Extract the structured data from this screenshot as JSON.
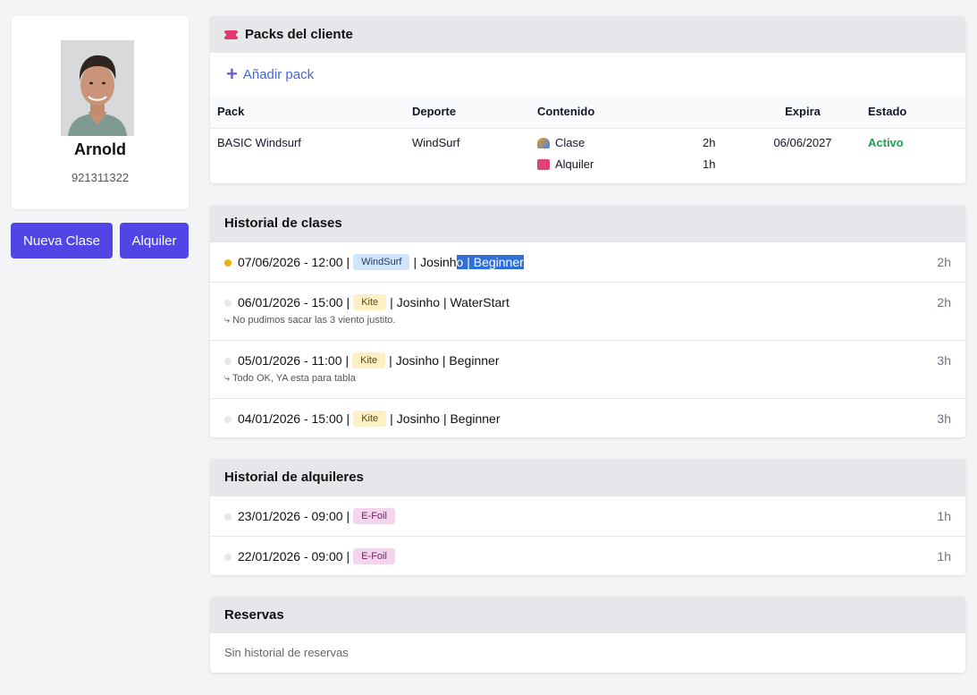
{
  "profile": {
    "name": "Arnold",
    "phone": "921311322"
  },
  "actions": {
    "new_class": "Nueva Clase",
    "rental": "Alquiler"
  },
  "packs": {
    "title": "Packs del cliente",
    "add_label": "Añadir pack",
    "columns": [
      "Pack",
      "Deporte",
      "Contenido",
      "Expira",
      "Estado"
    ],
    "rows": [
      {
        "pack": "BASIC Windsurf",
        "sport": "WindSurf",
        "content": [
          {
            "icon": "surfer-icon",
            "label": "Clase",
            "qty": "2h"
          },
          {
            "icon": "suitcase-icon",
            "label": "Alquiler",
            "qty": "1h"
          }
        ],
        "expires": "06/06/2027",
        "status": "Activo"
      }
    ]
  },
  "classes": {
    "title": "Historial de clases",
    "items": [
      {
        "datetime": "07/06/2026 - 12:00",
        "sport": "WindSurf",
        "instructor_pre": "Josinh",
        "instructor_sel": "o | Beginner",
        "rest": "",
        "hours": "2h",
        "note": "",
        "active": true
      },
      {
        "datetime": "06/01/2026 - 15:00",
        "sport": "Kite",
        "rest": "Josinho | WaterStart",
        "hours": "2h",
        "note": "No pudimos sacar las 3 viento justito.",
        "active": false
      },
      {
        "datetime": "05/01/2026 - 11:00",
        "sport": "Kite",
        "rest": "Josinho | Beginner",
        "hours": "3h",
        "note": "Todo OK, YA esta para tabla",
        "active": false
      },
      {
        "datetime": "04/01/2026 - 15:00",
        "sport": "Kite",
        "rest": "Josinho | Beginner",
        "hours": "3h",
        "note": "",
        "active": false
      }
    ]
  },
  "rentals": {
    "title": "Historial de alquileres",
    "items": [
      {
        "datetime": "23/01/2026 - 09:00",
        "item": "E-Foil",
        "hours": "1h"
      },
      {
        "datetime": "22/01/2026 - 09:00",
        "item": "E-Foil",
        "hours": "1h"
      }
    ]
  },
  "bookings": {
    "title": "Reservas",
    "empty": "Sin historial de reservas"
  },
  "separator": "|",
  "note_prefix": "⤷",
  "colors": {
    "accent": "#5145e5",
    "active_status": "#16a34a",
    "pending_dot": "#eab308"
  }
}
